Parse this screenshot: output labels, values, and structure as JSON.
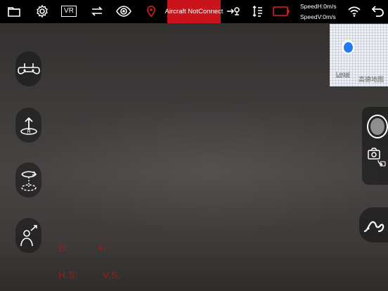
{
  "topbar": {
    "status": "Aircraft NotConnect",
    "speed_h": "SpeedH:0m/s",
    "speed_v": "SpeedV:0m/s",
    "vr_label": "VR",
    "icons": [
      "folder-icon",
      "settings-icon",
      "vr-icon",
      "switch-camera-icon",
      "eye-icon",
      "location-icon",
      "return-home-icon",
      "height-limit-icon",
      "battery-icon",
      "wifi-icon",
      "back-icon"
    ],
    "accent_color": "#c8141a",
    "battery_color": "#e02020"
  },
  "left_buttons": [
    {
      "name": "remote-controller-button",
      "icon": "gamepad-icon"
    },
    {
      "name": "takeoff-button",
      "icon": "takeoff-icon"
    },
    {
      "name": "circle-mode-button",
      "icon": "orbit-icon"
    },
    {
      "name": "follow-me-button",
      "icon": "follow-icon"
    }
  ],
  "map": {
    "legal": "Legal",
    "label": "高德地图"
  },
  "right_panel": {
    "icons": [
      "shutter-button",
      "camera-switch-icon",
      "route-icon"
    ]
  },
  "telemetry": {
    "distance": "D:",
    "height": "H:",
    "h_speed": "H.S:",
    "v_speed": "V.S:",
    "color": "#a01a1a"
  }
}
